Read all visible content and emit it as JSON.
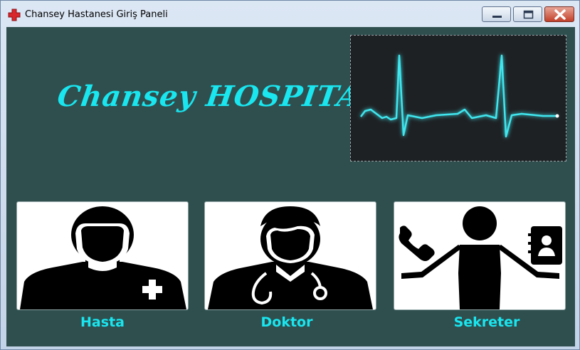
{
  "window": {
    "title": "Chansey Hastanesi Giriş Paneli",
    "icons": {
      "app": "red-cross-icon",
      "minimize": "minimize-icon",
      "maximize": "maximize-icon",
      "close": "close-icon"
    },
    "colors": {
      "client_bg": "#2f4f4f",
      "accent": "#19e6ef",
      "close": "#c2402a"
    }
  },
  "header": {
    "brand": "Chansey HOSPITAL"
  },
  "cards": [
    {
      "label": "Hasta",
      "icon": "patient-icon"
    },
    {
      "label": "Doktor",
      "icon": "doctor-icon"
    },
    {
      "label": "Sekreter",
      "icon": "secretary-icon"
    }
  ]
}
